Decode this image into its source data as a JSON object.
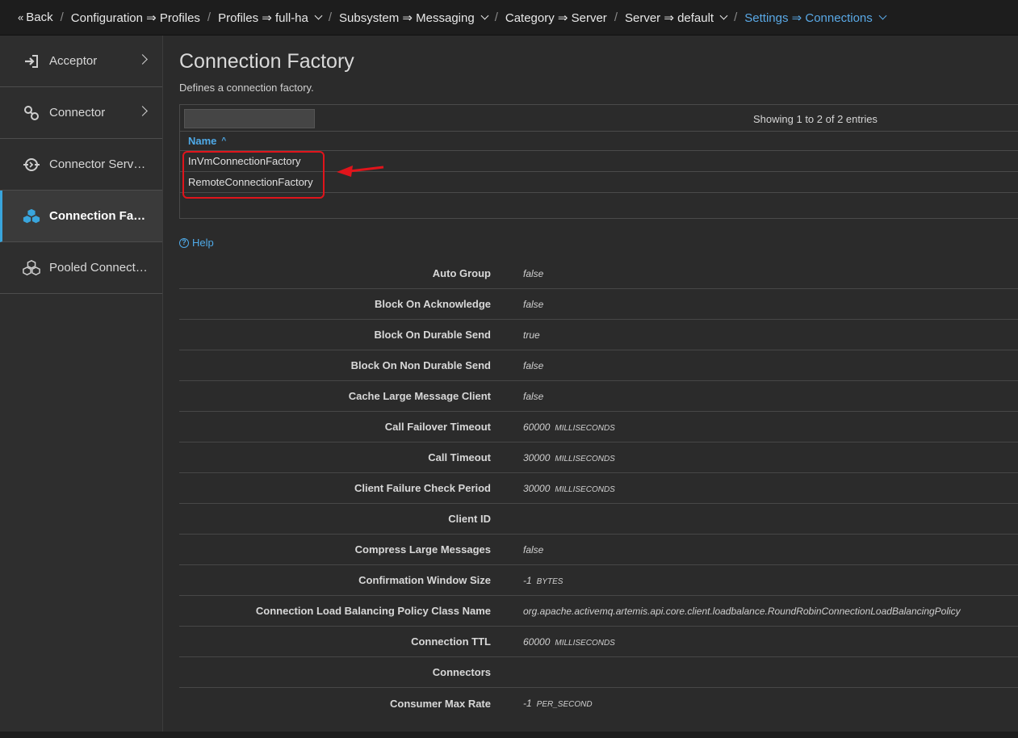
{
  "breadcrumb": {
    "back": "Back",
    "items": [
      {
        "label": "Configuration ⇒ Profiles"
      },
      {
        "label": "Profiles ⇒ full-ha"
      },
      {
        "label": "Subsystem ⇒ Messaging"
      },
      {
        "label": "Category ⇒ Server"
      },
      {
        "label": "Server ⇒ default"
      },
      {
        "label": "Settings ⇒ Connections"
      }
    ]
  },
  "sidebar": {
    "items": [
      {
        "label": "Acceptor",
        "icon": "sign-in-icon"
      },
      {
        "label": "Connector",
        "icon": "link-icon"
      },
      {
        "label": "Connector Service",
        "icon": "sync-icon"
      },
      {
        "label": "Connection Fact...",
        "icon": "cubes-icon"
      },
      {
        "label": "Pooled Connectio...",
        "icon": "cubes-pooled-icon"
      }
    ]
  },
  "main": {
    "title": "Connection Factory",
    "description": "Defines a connection factory.",
    "table": {
      "filter_value": "",
      "entries": "Showing 1 to 2 of 2 entries",
      "column_header": "Name",
      "sort_indicator": "^",
      "rows": [
        "InVmConnectionFactory",
        "RemoteConnectionFactory"
      ]
    },
    "help_label": "Help",
    "attributes": [
      {
        "name": "Auto Group",
        "value": "false",
        "unit": ""
      },
      {
        "name": "Block On Acknowledge",
        "value": "false",
        "unit": ""
      },
      {
        "name": "Block On Durable Send",
        "value": "true",
        "unit": ""
      },
      {
        "name": "Block On Non Durable Send",
        "value": "false",
        "unit": ""
      },
      {
        "name": "Cache Large Message Client",
        "value": "false",
        "unit": ""
      },
      {
        "name": "Call Failover Timeout",
        "value": "60000",
        "unit": "MILLISECONDS"
      },
      {
        "name": "Call Timeout",
        "value": "30000",
        "unit": "MILLISECONDS"
      },
      {
        "name": "Client Failure Check Period",
        "value": "30000",
        "unit": "MILLISECONDS"
      },
      {
        "name": "Client ID",
        "value": "",
        "unit": ""
      },
      {
        "name": "Compress Large Messages",
        "value": "false",
        "unit": ""
      },
      {
        "name": "Confirmation Window Size",
        "value": "-1",
        "unit": "BYTES"
      },
      {
        "name": "Connection Load Balancing Policy Class Name",
        "value": "org.apache.activemq.artemis.api.core.client.loadbalance.RoundRobinConnectionLoadBalancingPolicy",
        "unit": ""
      },
      {
        "name": "Connection TTL",
        "value": "60000",
        "unit": "MILLISECONDS"
      },
      {
        "name": "Connectors",
        "value": "",
        "unit": ""
      },
      {
        "name": "Consumer Max Rate",
        "value": "-1",
        "unit": "PER_SECOND"
      }
    ]
  },
  "colors": {
    "accent": "#39a5dc",
    "link": "#4faae8",
    "annotation": "#e0141b",
    "background": "#2b2b2b"
  }
}
